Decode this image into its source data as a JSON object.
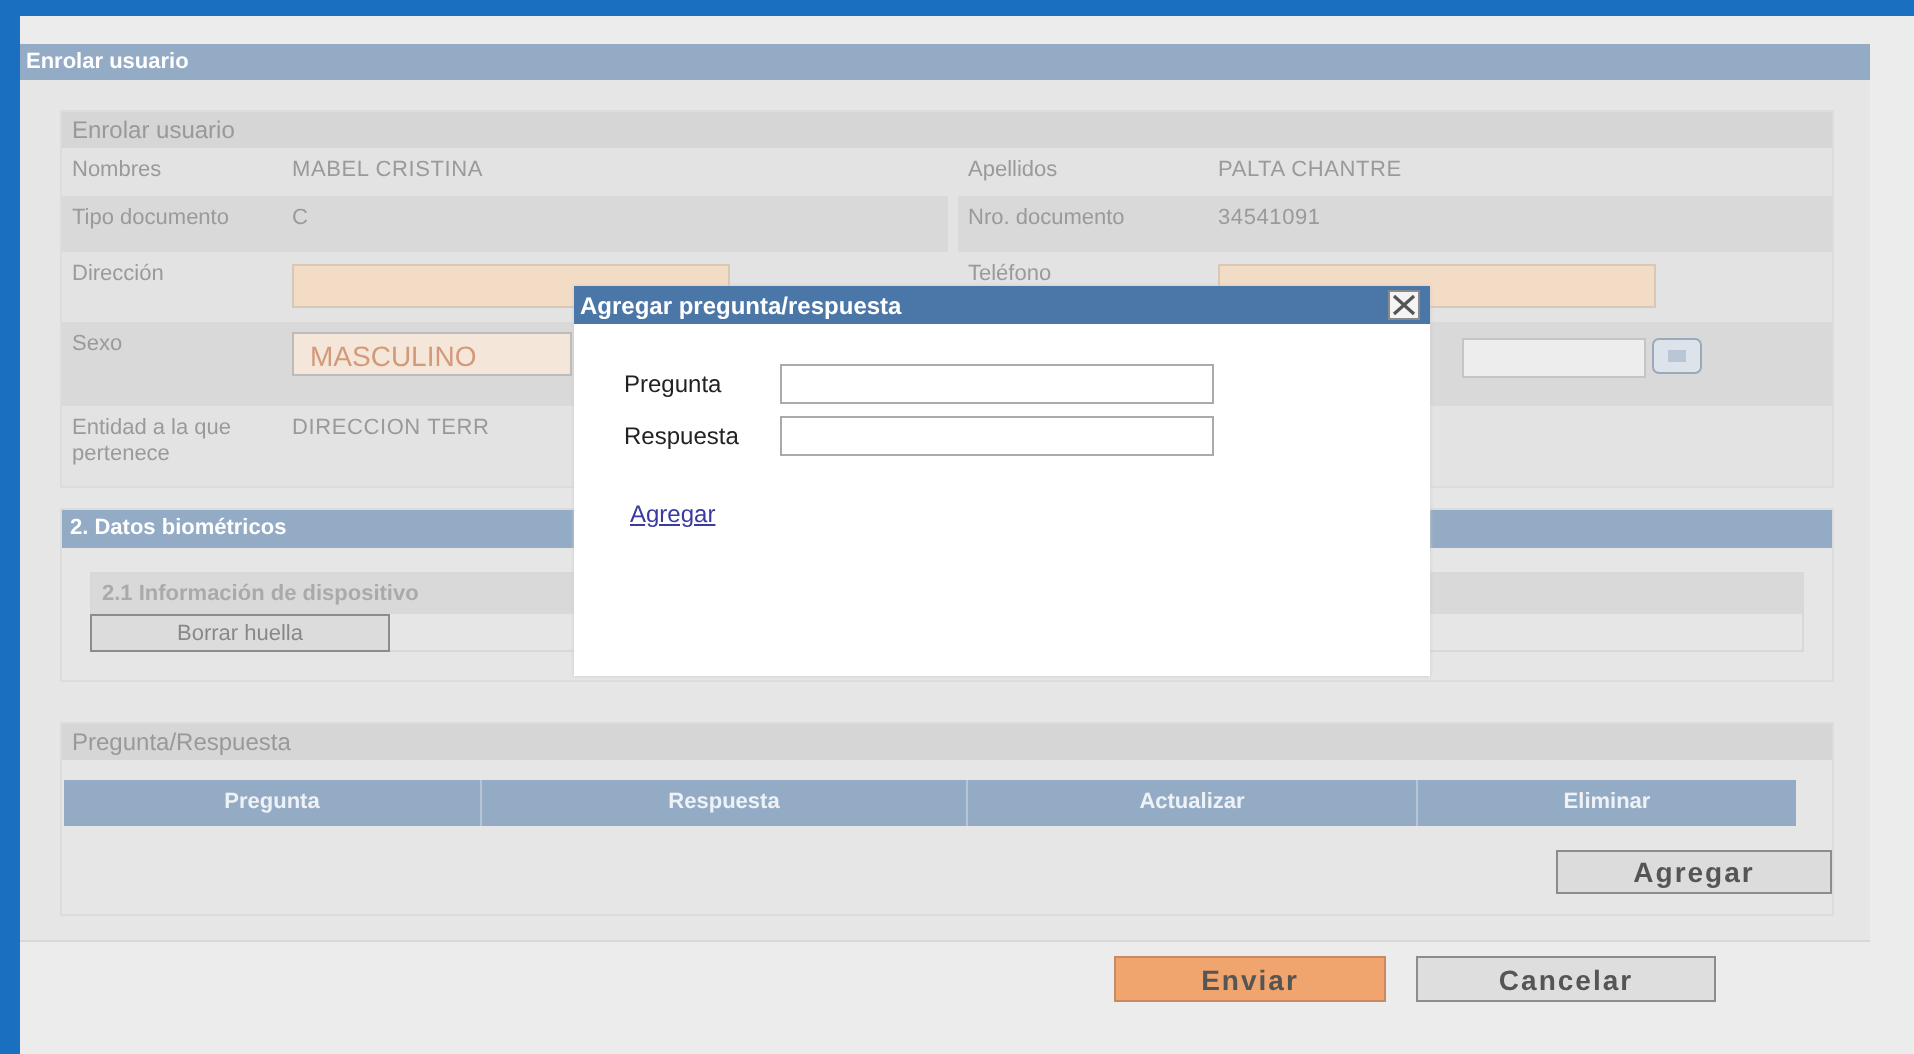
{
  "panel": {
    "title": "Enrolar usuario"
  },
  "user_section": {
    "title": "Enrolar usuario",
    "rows": [
      {
        "left": {
          "label": "Nombres",
          "value": "MABEL CRISTINA",
          "kind": "text"
        },
        "right": {
          "label": "Apellidos",
          "value": "PALTA CHANTRE",
          "kind": "text"
        }
      },
      {
        "left": {
          "label": "Tipo documento",
          "value": "C",
          "kind": "text"
        },
        "right": {
          "label": "Nro. documento",
          "value": "34541091",
          "kind": "text"
        }
      },
      {
        "left": {
          "label": "Dirección",
          "kind": "input"
        },
        "right": {
          "label": "Teléfono",
          "kind": "input"
        }
      },
      {
        "left": {
          "label": "Sexo",
          "value": "MASCULINO",
          "kind": "select"
        },
        "right": {
          "kind": "picker"
        }
      },
      {
        "left": {
          "label": "Entidad a la que pertenece",
          "value": "DIRECCION TERR",
          "kind": "text"
        }
      }
    ]
  },
  "biometrics": {
    "title": "2. Datos biométricos",
    "subsection": "2.1 Información de dispositivo",
    "button": "Borrar huella"
  },
  "qa": {
    "title": "Pregunta/Respuesta",
    "columns": [
      "Pregunta",
      "Respuesta",
      "Actualizar",
      "Eliminar"
    ],
    "add_button": "Agregar"
  },
  "actions": [
    {
      "label": "Enviar",
      "kind": "primary"
    },
    {
      "label": "Cancelar",
      "kind": "secondary"
    }
  ],
  "dialog": {
    "title": "Agregar pregunta/respuesta",
    "fields": [
      {
        "label": "Pregunta"
      },
      {
        "label": "Respuesta"
      }
    ],
    "link": "Agregar"
  }
}
